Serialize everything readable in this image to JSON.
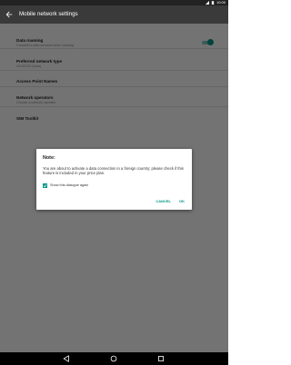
{
  "status_bar": {
    "time": "10:00"
  },
  "app_bar": {
    "title": "Mobile network settings"
  },
  "settings": [
    {
      "title": "Data roaming",
      "subtitle": "Connect to data services when roaming"
    },
    {
      "title": "Preferred network type",
      "subtitle": "4G/3G/2G (Auto)"
    },
    {
      "title": "Access Point Names",
      "subtitle": ""
    },
    {
      "title": "Network operators",
      "subtitle": "Choose a network operator"
    },
    {
      "title": "SIM Toolkit",
      "subtitle": ""
    }
  ],
  "data_roaming_enabled": true,
  "dialog": {
    "title": "Note:",
    "message": "You are about to activate a data connection in a foreign country; please check if this feature is included in your price plan.",
    "checkbox_label": "Show this dialogue again",
    "checkbox_checked": true,
    "cancel_label": "CANCEL",
    "ok_label": "OK"
  },
  "colors": {
    "accent": "#009688",
    "app_bar": "#3a3a3a",
    "status_bar": "#222222"
  }
}
